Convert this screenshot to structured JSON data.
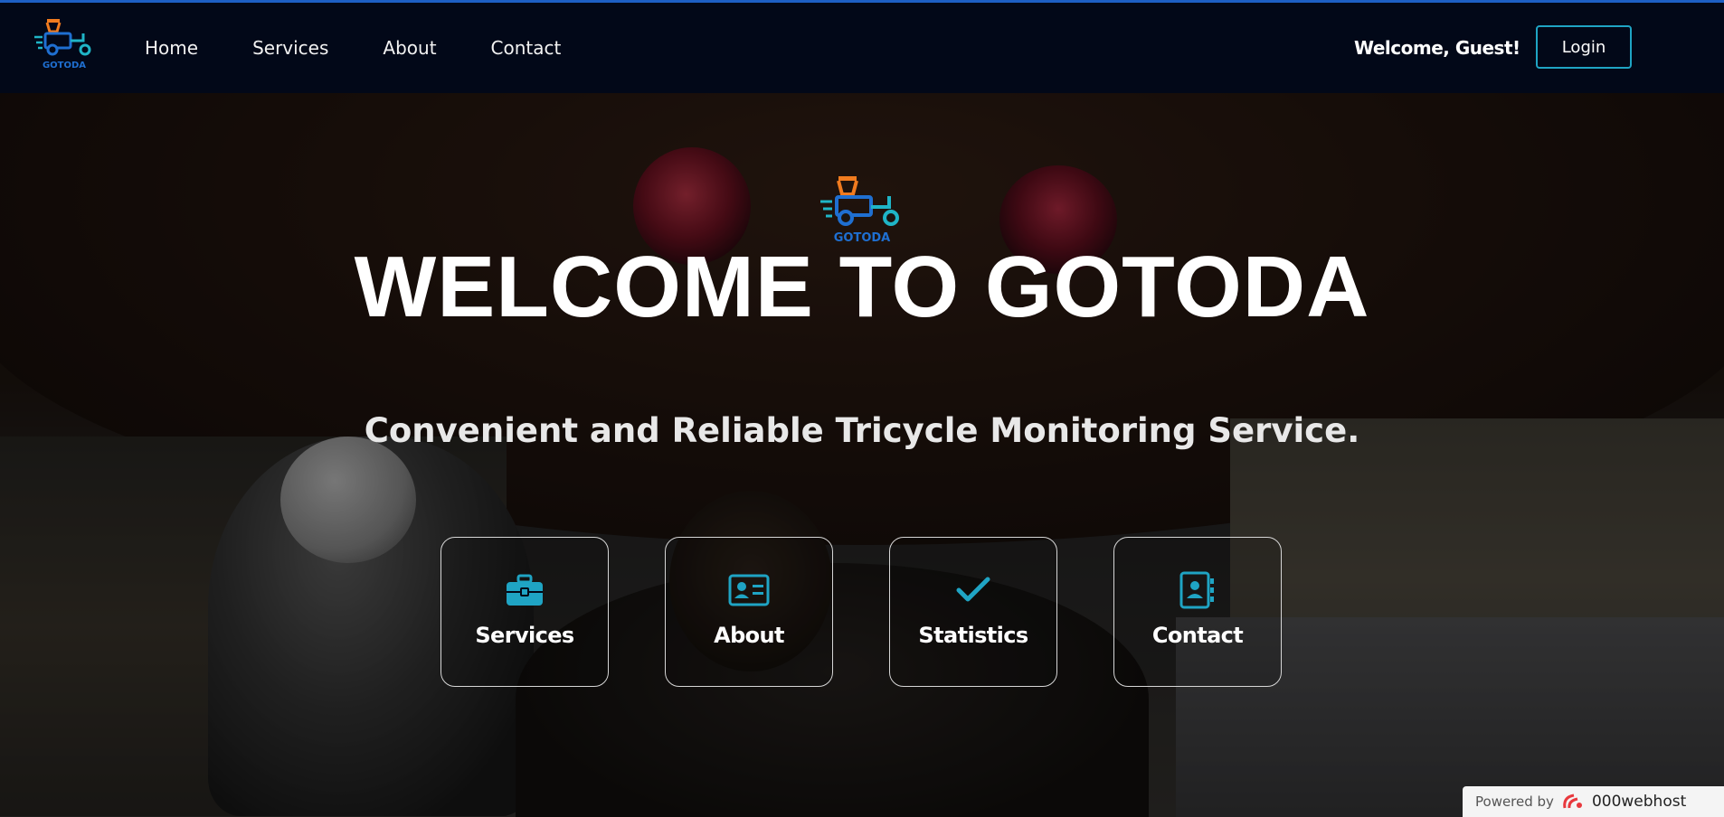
{
  "header": {
    "logo_text": "GOTODA",
    "nav": [
      {
        "label": "Home"
      },
      {
        "label": "Services"
      },
      {
        "label": "About"
      },
      {
        "label": "Contact"
      }
    ],
    "welcome_text": "Welcome, Guest!",
    "login_label": "Login"
  },
  "hero": {
    "logo_text": "GOTODA",
    "title": "WELCOME TO GOTODA",
    "subtitle": "Convenient and Reliable Tricycle Monitoring Service."
  },
  "cards": [
    {
      "label": "Services",
      "icon": "toolbox-icon"
    },
    {
      "label": "About",
      "icon": "id-card-icon"
    },
    {
      "label": "Statistics",
      "icon": "checkmark-icon"
    },
    {
      "label": "Contact",
      "icon": "contact-book-icon"
    }
  ],
  "footer_badge": {
    "powered_by": "Powered by",
    "brand": "000webhost"
  },
  "colors": {
    "accent": "#1fa4c4",
    "navbar_bg": "#020818",
    "logo_orange": "#f07b1f",
    "logo_blue": "#1f6fd1",
    "logo_teal": "#1fb5c7"
  }
}
